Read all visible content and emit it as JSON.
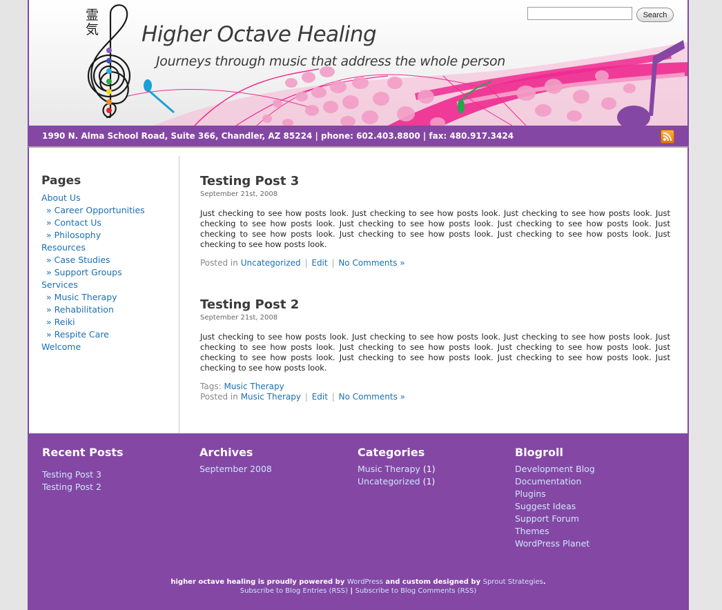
{
  "header": {
    "title": "Higher Octave Healing",
    "tagline": "Journeys through music that address the whole person",
    "logo_glyph": "霊気",
    "search_placeholder": "",
    "search_label": "Search"
  },
  "address_bar": {
    "text": "1990 N. Alma School Road, Suite 366, Chandler, AZ 85224 | phone: 602.403.8800 | fax: 480.917.3424",
    "rss_icon": "rss-icon"
  },
  "sidebar": {
    "heading": "Pages",
    "items": [
      {
        "label": "About Us",
        "sub": false
      },
      {
        "label": "Career Opportunities",
        "sub": true
      },
      {
        "label": "Contact Us",
        "sub": true
      },
      {
        "label": "Philosophy",
        "sub": true
      },
      {
        "label": "Resources",
        "sub": false
      },
      {
        "label": "Case Studies",
        "sub": true
      },
      {
        "label": "Support Groups",
        "sub": true
      },
      {
        "label": "Services",
        "sub": false
      },
      {
        "label": "Music Therapy",
        "sub": true
      },
      {
        "label": "Rehabilitation",
        "sub": true
      },
      {
        "label": "Reiki",
        "sub": true
      },
      {
        "label": "Respite Care",
        "sub": true
      },
      {
        "label": "Welcome",
        "sub": false
      }
    ]
  },
  "posts": [
    {
      "title": "Testing Post 3",
      "date": "September 21st, 2008",
      "body": "Just checking to see how posts look. Just checking to see how posts look. Just checking to see how posts look. Just checking to see how posts look. Just checking to see how posts look. Just checking to see how posts look. Just checking to see how posts look. Just checking to see how posts look. Just checking to see how posts look. Just checking to see how posts look.",
      "posted_in_label": "Posted in",
      "category": "Uncategorized",
      "edit": "Edit",
      "comments": "No Comments »"
    },
    {
      "title": "Testing Post 2",
      "date": "September 21st, 2008",
      "body": "Just checking to see how posts look. Just checking to see how posts look. Just checking to see how posts look. Just checking to see how posts look. Just checking to see how posts look. Just checking to see how posts look. Just checking to see how posts look. Just checking to see how posts look. Just checking to see how posts look. Just checking to see how posts look.",
      "tags_label": "Tags:",
      "tag": "Music Therapy",
      "posted_in_label": "Posted in",
      "category": "Music Therapy",
      "edit": "Edit",
      "comments": "No Comments »"
    }
  ],
  "footer": {
    "recent_posts": {
      "heading": "Recent Posts",
      "items": [
        "Testing Post 3",
        "Testing Post 2"
      ]
    },
    "archives": {
      "heading": "Archives",
      "items": [
        "September 2008"
      ]
    },
    "categories": {
      "heading": "Categories",
      "items": [
        {
          "label": "Music Therapy",
          "count": "(1)"
        },
        {
          "label": "Uncategorized",
          "count": "(1)"
        }
      ]
    },
    "blogroll": {
      "heading": "Blogroll",
      "items": [
        "Development Blog",
        "Documentation",
        "Plugins",
        "Suggest Ideas",
        "Support Forum",
        "Themes",
        "WordPress Planet"
      ]
    },
    "credits": {
      "prefix": "higher octave healing is proudly powered by",
      "wordpress": "WordPress",
      "middle": "and custom designed by",
      "designer": "Sprout Strategies",
      "end": ".",
      "rss_entries": "Subscribe to Blog Entries (RSS)",
      "sep": "|",
      "rss_comments": "Subscribe to Blog Comments (RSS)"
    }
  },
  "colors": {
    "brand_purple": "#8447a3",
    "link_blue": "#1a6fb3",
    "footer_link": "#cfe6ff",
    "accent_pink": "#ee2a8f"
  }
}
